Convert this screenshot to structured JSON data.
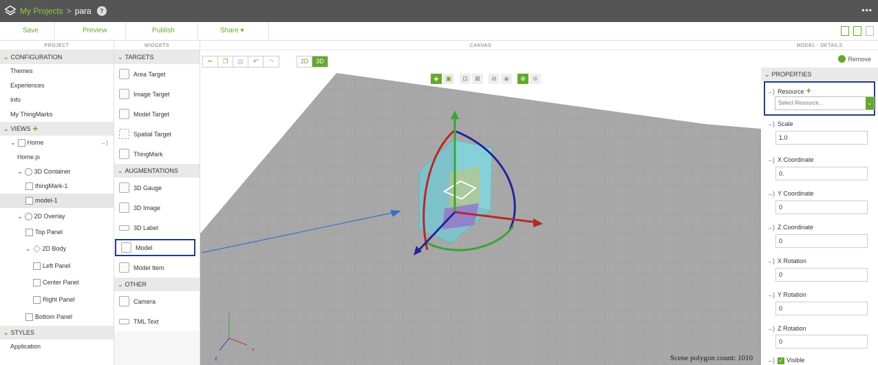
{
  "topbar": {
    "my_projects": "My Projects",
    "separator": ">",
    "project": "para"
  },
  "actions": {
    "save": "Save",
    "preview": "Preview",
    "publish": "Publish",
    "share": "Share",
    "share_chevron": "▾"
  },
  "project": {
    "header": "PROJECT",
    "configuration": "CONFIGURATION",
    "config_items": [
      "Themes",
      "Experiences",
      "Info",
      "My ThingMarks"
    ],
    "views": "VIEWS",
    "home": "Home",
    "homejs": "Home.js",
    "container3d": "3D Container",
    "thingmark": "thingMark-1",
    "model": "model-1",
    "overlay2d": "2D Overlay",
    "top_panel": "Top Panel",
    "body2d": "2D Body",
    "left_panel": "Left Panel",
    "center_panel": "Center Panel",
    "right_panel": "Right Panel",
    "bottom_panel": "Bottom Panel",
    "styles": "STYLES",
    "application": "Application"
  },
  "widgets": {
    "header": "WIDGETS",
    "targets": "TARGETS",
    "target_items": [
      "Area Target",
      "Image Target",
      "Model Target",
      "Spatial Target",
      "ThingMark"
    ],
    "augmentations": "AUGMENTATIONS",
    "aug_items": [
      "3D Gauge",
      "3D Image",
      "3D Label",
      "Model",
      "Model Item"
    ],
    "other": "OTHER",
    "other_items": [
      "Camera",
      "TML Text"
    ]
  },
  "canvas": {
    "header": "CANVAS",
    "btn_2d": "2D",
    "btn_3d": "3D",
    "polygon_count": "Scene polygon count: 1010",
    "axis_x": "x",
    "axis_z": "z"
  },
  "details": {
    "header": "MODEL - DETAILS",
    "remove": "Remove",
    "properties": "PROPERTIES",
    "resource_label": "Resource",
    "resource_placeholder": "Select Resource...",
    "scale_label": "Scale",
    "scale": "1.0",
    "x_coord_label": "X Coordinate",
    "x_coord": "0.",
    "y_coord_label": "Y Coordinate",
    "y_coord": "0",
    "z_coord_label": "Z Coordinate",
    "z_coord": "0",
    "x_rot_label": "X Rotation",
    "x_rot": "0",
    "y_rot_label": "Y Rotation",
    "y_rot": "0",
    "z_rot_label": "Z Rotation",
    "z_rot": "0",
    "visible_label": "Visible"
  },
  "colors": {
    "accent": "#64a82d",
    "highlight_box": "#1f3e7a",
    "topbar": "#555555"
  }
}
